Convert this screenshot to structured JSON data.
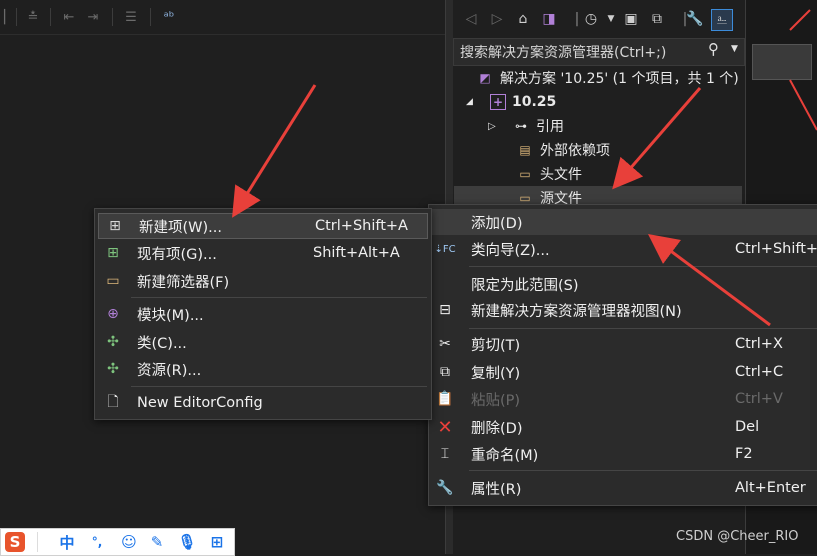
{
  "solution_explorer": {
    "search_label": "搜索解决方案资源管理器(Ctrl+;)",
    "tree": [
      {
        "label": "解决方案 '10.25' (1 个项目，共 1 个)",
        "icon": "solution-icon"
      },
      {
        "label": "10.25",
        "icon": "project-icon",
        "expander": "◢"
      },
      {
        "label": "引用",
        "icon": "reference-icon",
        "expander": "▷"
      },
      {
        "label": "外部依赖项",
        "icon": "external-deps-icon"
      },
      {
        "label": "头文件",
        "icon": "folder-icon"
      },
      {
        "label": "源文件",
        "icon": "folder-icon"
      }
    ]
  },
  "context_menu": {
    "items": [
      {
        "label": "添加(D)",
        "shortcut": ""
      },
      {
        "label": "类向导(Z)...",
        "shortcut": "Ctrl+Shift+"
      },
      {
        "label": "限定为此范围(S)",
        "shortcut": ""
      },
      {
        "label": "新建解决方案资源管理器视图(N)",
        "shortcut": ""
      },
      {
        "label": "剪切(T)",
        "shortcut": "Ctrl+X"
      },
      {
        "label": "复制(Y)",
        "shortcut": "Ctrl+C"
      },
      {
        "label": "粘贴(P)",
        "shortcut": "Ctrl+V"
      },
      {
        "label": "删除(D)",
        "shortcut": "Del"
      },
      {
        "label": "重命名(M)",
        "shortcut": "F2"
      },
      {
        "label": "属性(R)",
        "shortcut": "Alt+Enter"
      }
    ]
  },
  "submenu": {
    "items": [
      {
        "label": "新建项(W)...",
        "shortcut": "Ctrl+Shift+A"
      },
      {
        "label": "现有项(G)...",
        "shortcut": "Shift+Alt+A"
      },
      {
        "label": "新建筛选器(F)",
        "shortcut": ""
      },
      {
        "label": "模块(M)...",
        "shortcut": ""
      },
      {
        "label": "类(C)...",
        "shortcut": ""
      },
      {
        "label": "资源(R)...",
        "shortcut": ""
      },
      {
        "label": "New EditorConfig",
        "shortcut": ""
      }
    ]
  },
  "ime_toolbar": {
    "chinese_label": "中",
    "punct_label": "°,"
  },
  "watermark": "CSDN @Cheer_RIO",
  "colors": {
    "accent": "#3c8bd9",
    "arrow": "#e8403a",
    "menu_bg": "#2b2b2b",
    "selection": "#3d3d3d"
  }
}
